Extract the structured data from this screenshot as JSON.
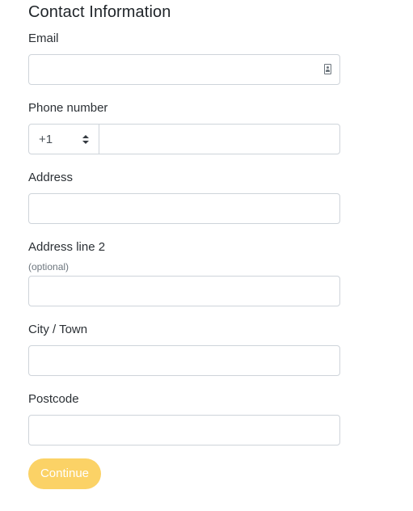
{
  "form": {
    "title": "Contact Information",
    "email": {
      "label": "Email",
      "value": "",
      "icon": "contact-card-icon"
    },
    "phone": {
      "label": "Phone number",
      "country_code": "+1",
      "value": "",
      "icon": "sort-icon"
    },
    "address": {
      "label": "Address",
      "value": ""
    },
    "address2": {
      "label": "Address line 2",
      "hint": "(optional)",
      "value": ""
    },
    "city": {
      "label": "City / Town",
      "value": ""
    },
    "postcode": {
      "label": "Postcode",
      "value": ""
    },
    "continue_label": "Continue"
  },
  "colors": {
    "button_bg": "#fbd266",
    "button_text": "#ffffff",
    "input_border": "#ced4da",
    "label_text": "#2b3035",
    "hint_text": "#6c757d"
  }
}
